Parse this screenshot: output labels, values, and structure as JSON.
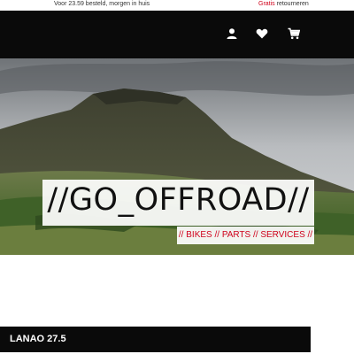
{
  "topbar": {
    "shipping_text": "Voor 23.59 besteld, morgen in huis",
    "returns_highlight": "Gratis",
    "returns_text": " retourneren"
  },
  "header": {
    "icons": [
      "account-icon",
      "heart-icon",
      "cart-icon"
    ]
  },
  "hero": {
    "title": "//GO_OFFROAD//",
    "subtitle": "// BIKES // PARTS // SERVICES //"
  },
  "product": {
    "name": "LANAO 27.5"
  },
  "colors": {
    "accent": "#d0021b",
    "header_bg": "#0a0a0a"
  }
}
